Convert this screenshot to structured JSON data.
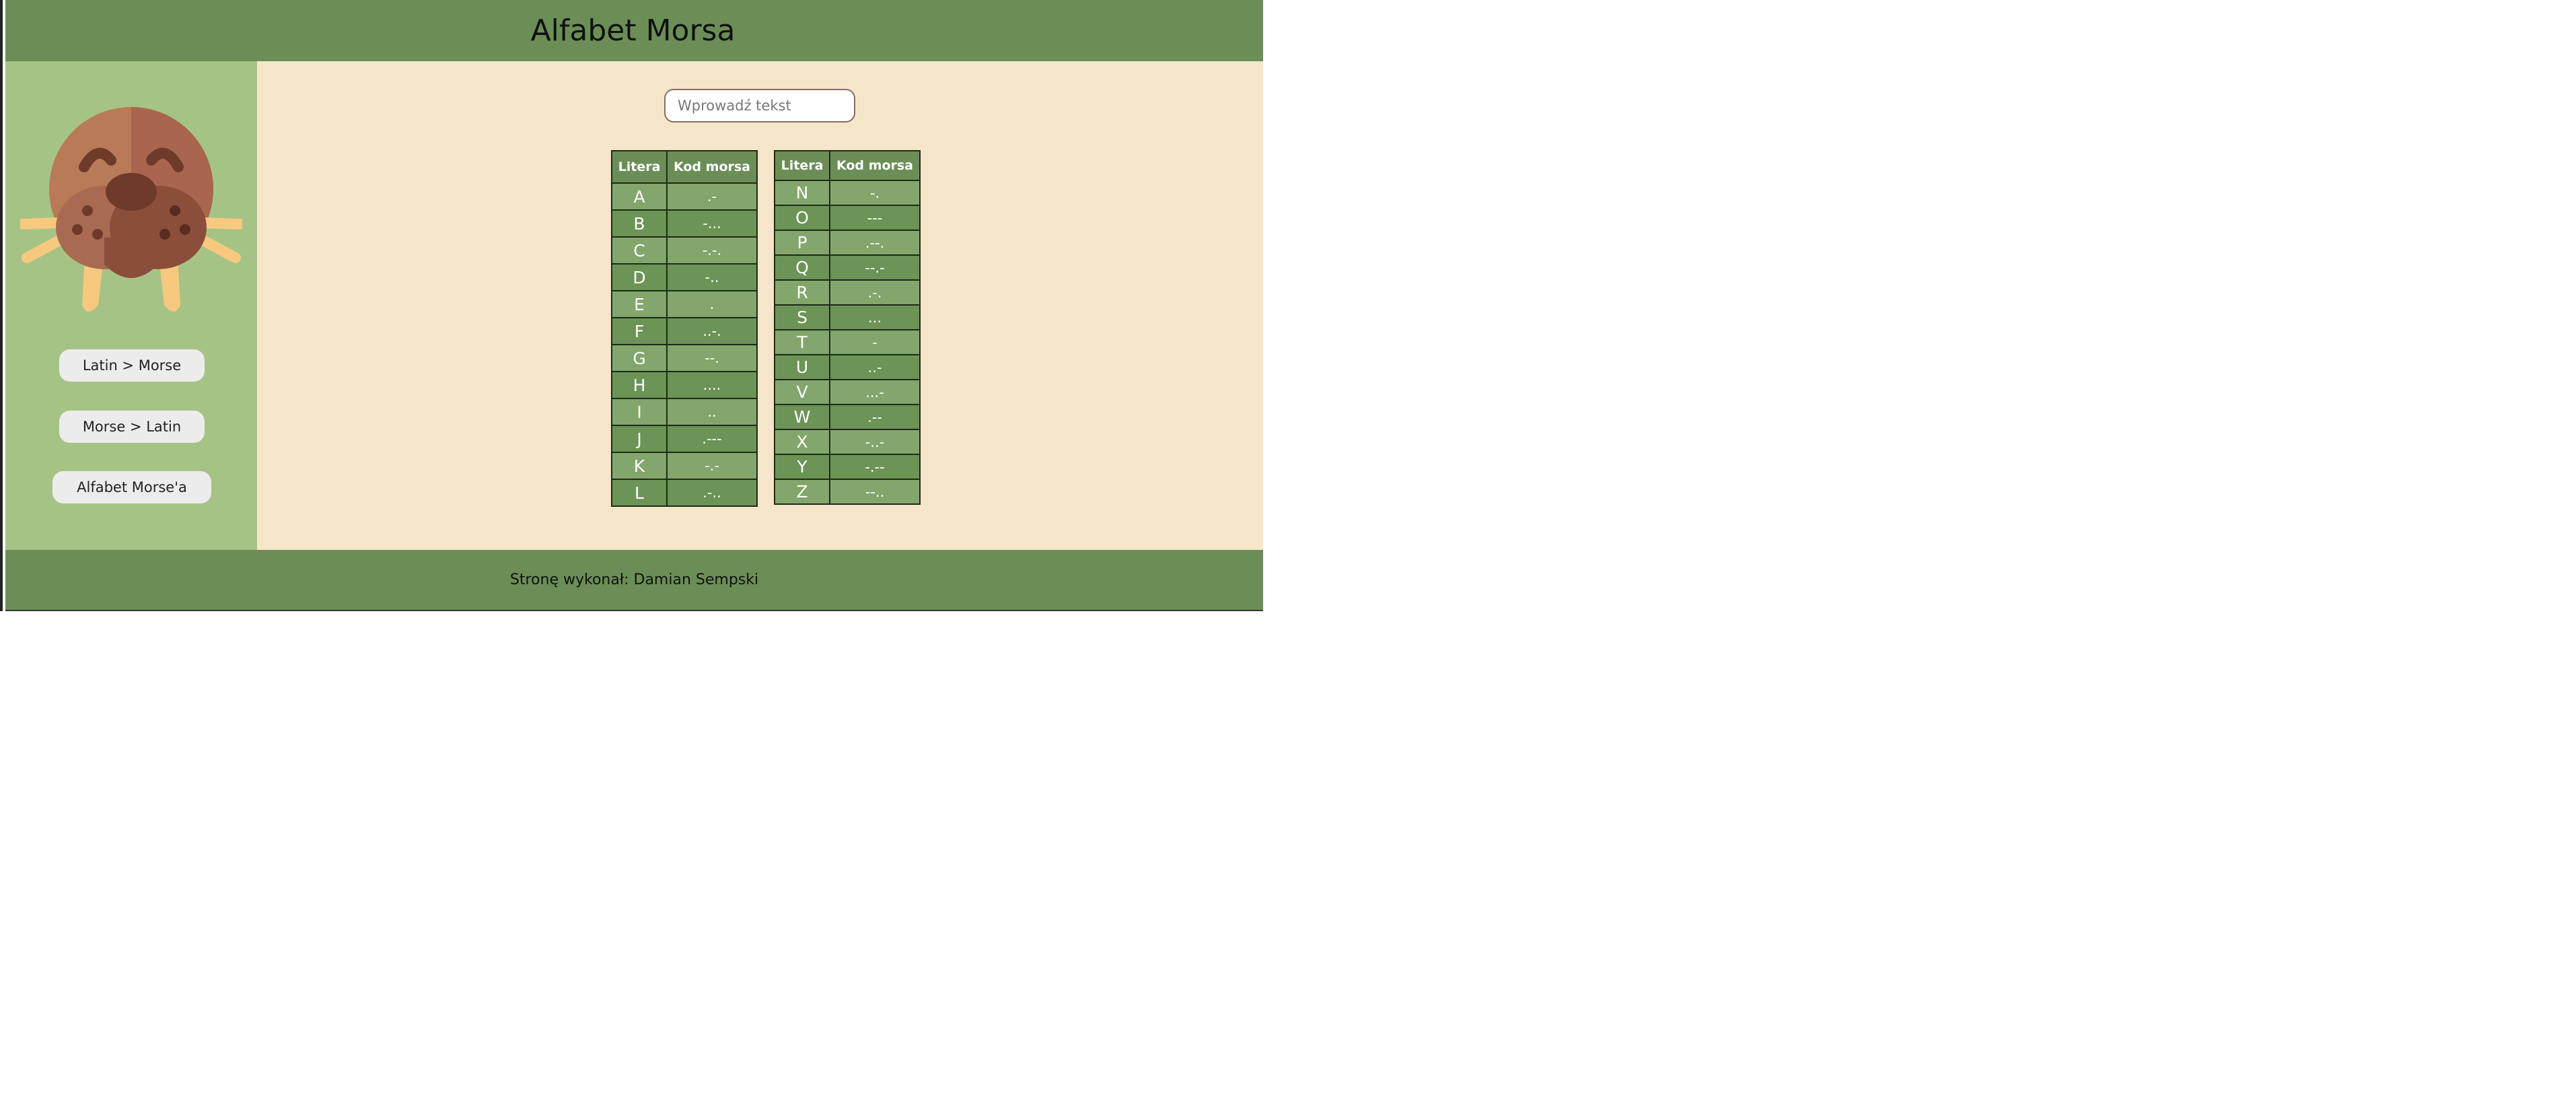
{
  "header": {
    "title": "Alfabet Morsa"
  },
  "sidebar": {
    "buttons": [
      {
        "label": "Latin > Morse"
      },
      {
        "label": "Morse > Latin"
      },
      {
        "label": "Alfabet Morse'a"
      }
    ]
  },
  "main": {
    "search": {
      "placeholder": "Wprowadź tekst",
      "value": ""
    },
    "columns": {
      "letter": "Litera",
      "code": "Kod morsa"
    },
    "left_table": [
      [
        "A",
        ".-"
      ],
      [
        "B",
        "-..."
      ],
      [
        "C",
        "-.-."
      ],
      [
        "D",
        "-.."
      ],
      [
        "E",
        "."
      ],
      [
        "F",
        "..-."
      ],
      [
        "G",
        "--."
      ],
      [
        "H",
        "...."
      ],
      [
        "I",
        ".."
      ],
      [
        "J",
        ".---"
      ],
      [
        "K",
        "-.-"
      ],
      [
        "L",
        ".-.."
      ]
    ],
    "right_table": [
      [
        "N",
        "-."
      ],
      [
        "O",
        "---"
      ],
      [
        "P",
        ".--."
      ],
      [
        "Q",
        "--.-"
      ],
      [
        "R",
        ".-."
      ],
      [
        "S",
        "..."
      ],
      [
        "T",
        "-"
      ],
      [
        "U",
        "..-"
      ],
      [
        "V",
        "...-"
      ],
      [
        "W",
        ".--"
      ],
      [
        "X",
        "-..-"
      ],
      [
        "Y",
        "-.--"
      ],
      [
        "Z",
        "--.."
      ]
    ]
  },
  "footer": {
    "text": "Stronę wykonał: Damian Sempski"
  },
  "colors": {
    "header_bg": "#6b8e57",
    "sidebar_bg": "#a6c386",
    "main_bg": "#f5e6c9",
    "table_row_light": "#82a66c",
    "table_row_dark": "#6b9456",
    "button_bg": "#ececec"
  },
  "icons": {
    "logo": "walrus-icon"
  }
}
